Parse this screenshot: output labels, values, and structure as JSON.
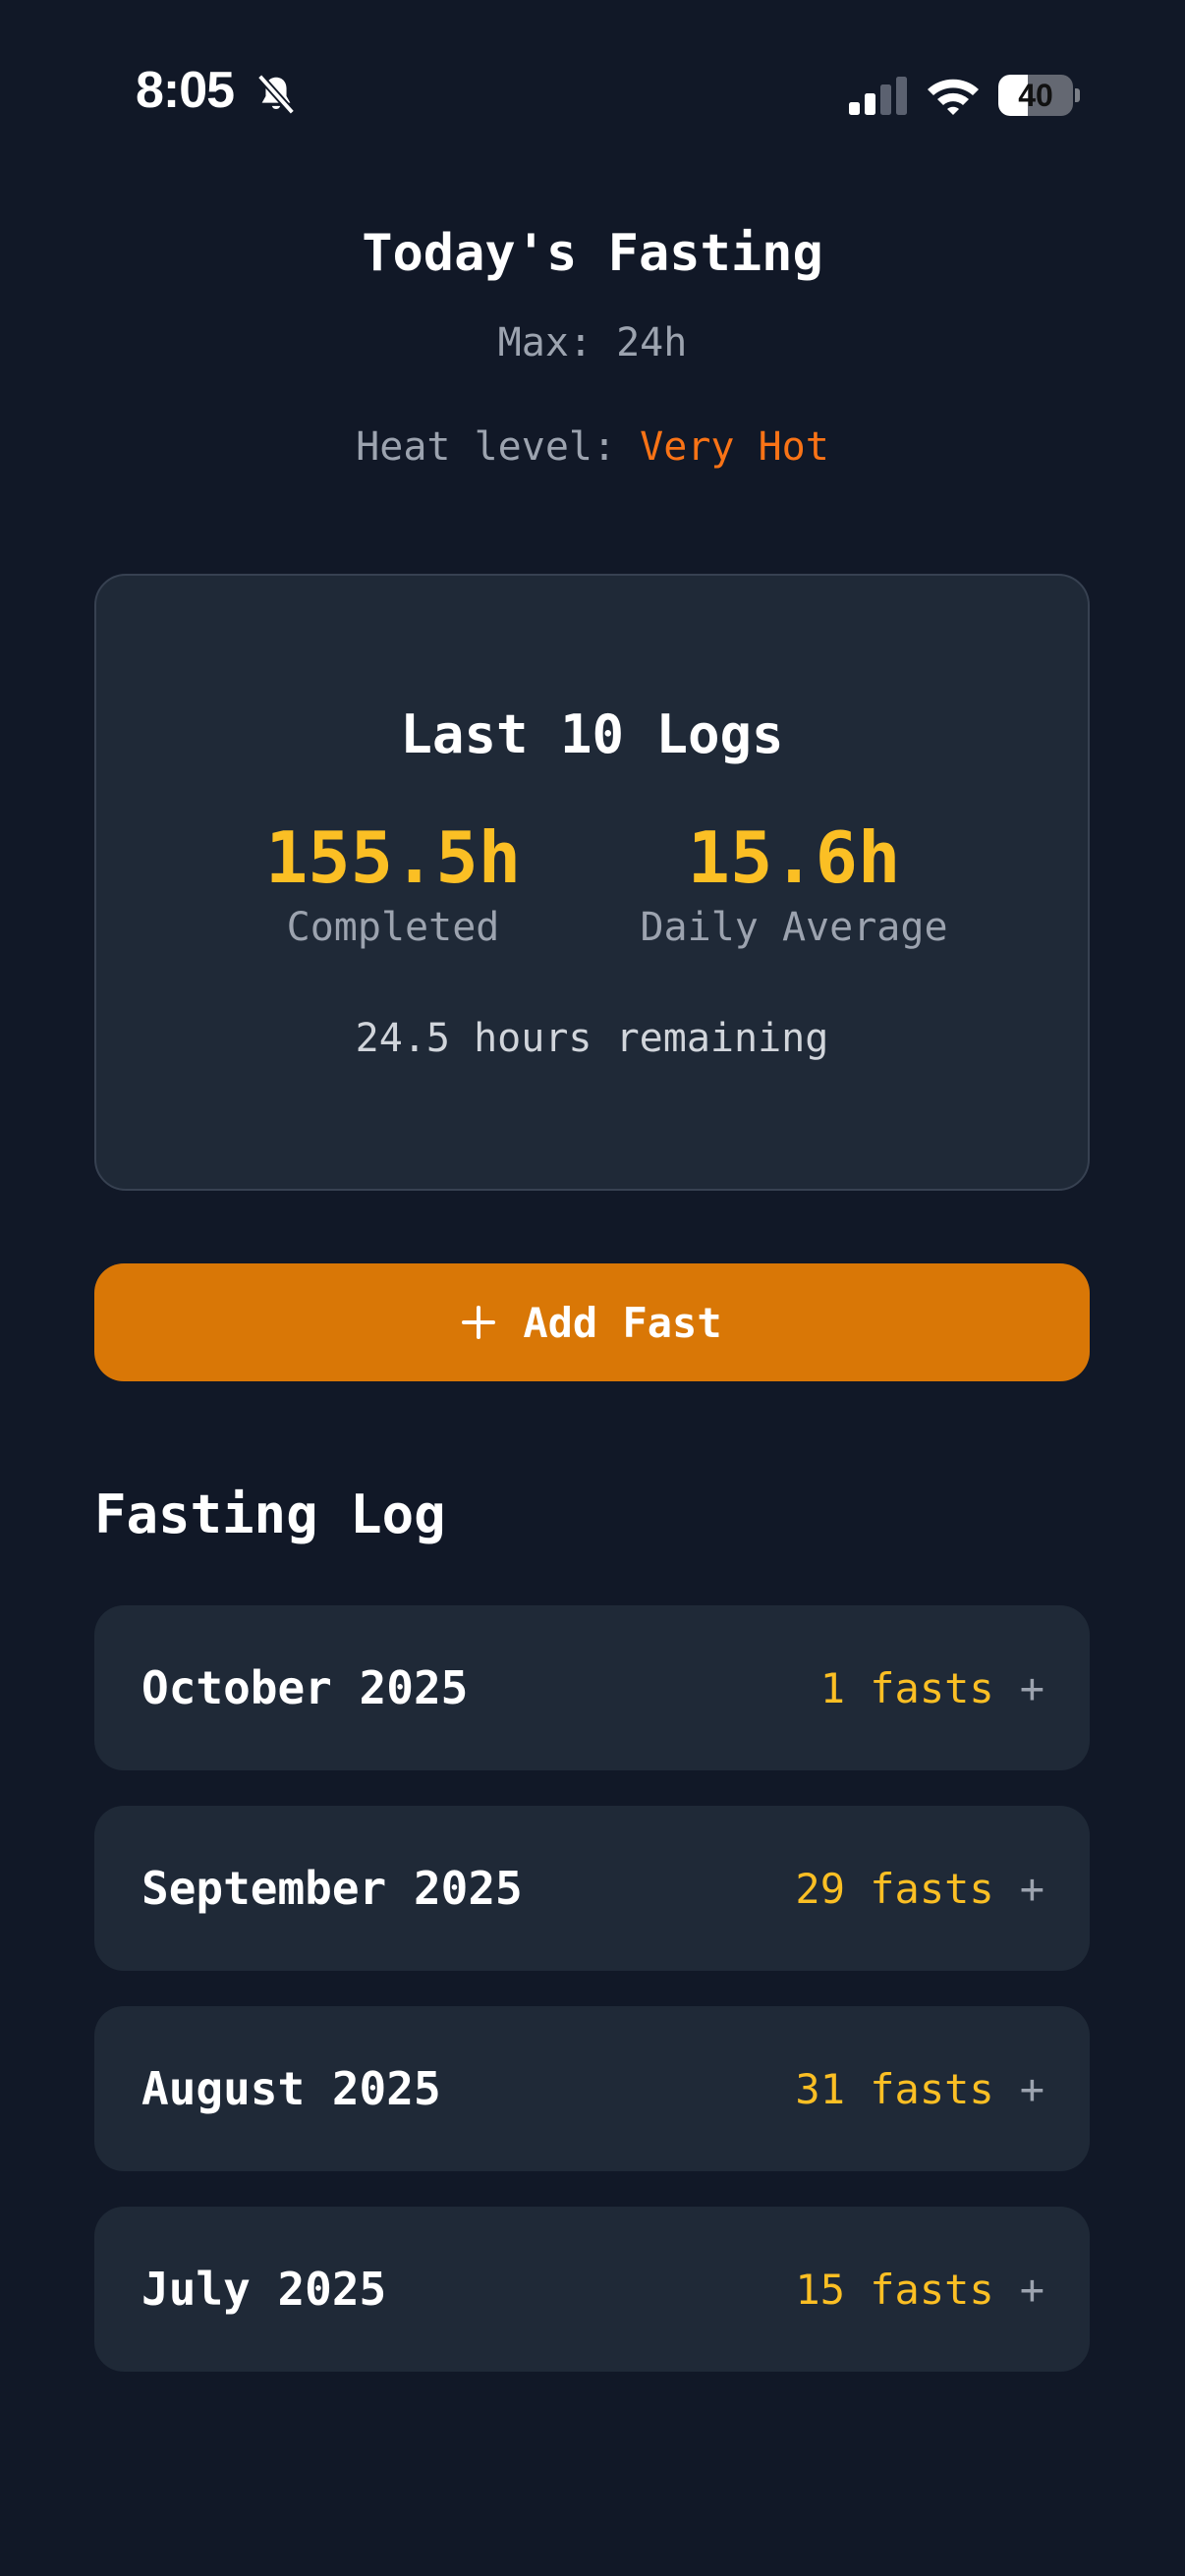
{
  "status_bar": {
    "time": "8:05",
    "battery_level": "40",
    "battery_fraction": 0.4
  },
  "header": {
    "title": "Today's Fasting",
    "max": "Max: 24h",
    "heat_label": "Heat level: ",
    "heat_value": "Very Hot"
  },
  "stats": {
    "title": "Last 10 Logs",
    "completed_value": "155.5h",
    "completed_label": "Completed",
    "average_value": "15.6h",
    "average_label": "Daily Average",
    "remaining": "24.5 hours remaining"
  },
  "add_button": {
    "label": "Add Fast"
  },
  "log": {
    "heading": "Fasting Log",
    "months": [
      {
        "month": "October 2025",
        "count": "1 fasts",
        "expand": "+"
      },
      {
        "month": "September 2025",
        "count": "29 fasts",
        "expand": "+"
      },
      {
        "month": "August 2025",
        "count": "31 fasts",
        "expand": "+"
      },
      {
        "month": "July 2025",
        "count": "15 fasts",
        "expand": "+"
      }
    ]
  },
  "colors": {
    "background": "#111827",
    "card": "#1f2937",
    "accent_amber": "#fbbf24",
    "accent_orange": "#f97316",
    "button": "#d97706"
  },
  "icons": {
    "status": [
      "bell-off-icon",
      "signal-icon",
      "wifi-icon",
      "battery-icon"
    ],
    "add": "plus-icon"
  }
}
